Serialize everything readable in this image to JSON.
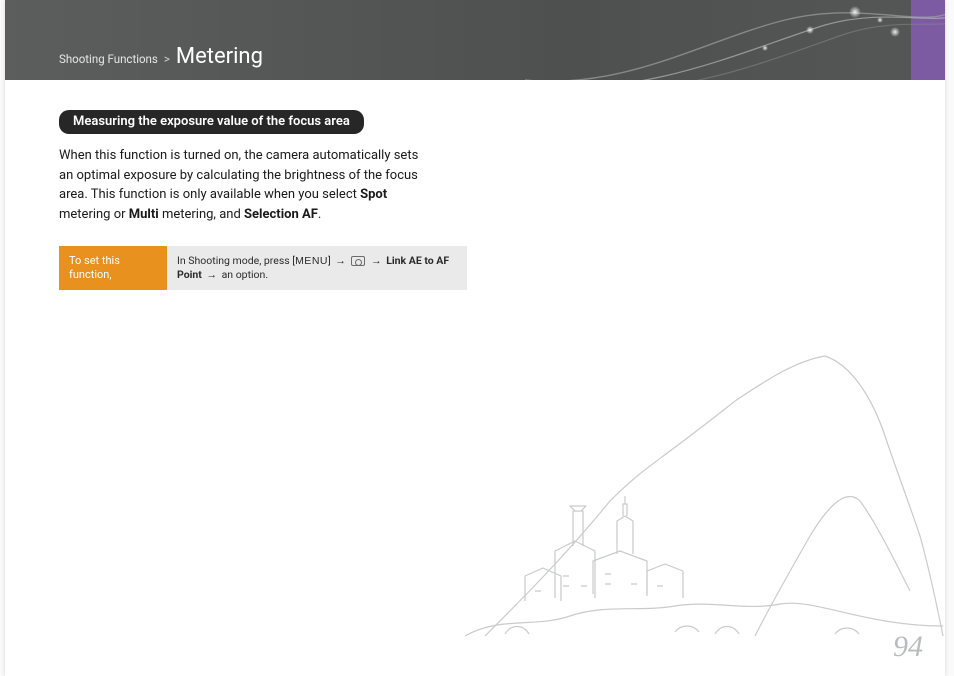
{
  "breadcrumb": {
    "section": "Shooting Functions",
    "separator": ">",
    "title": "Metering"
  },
  "heading": "Measuring the exposure value of the focus area",
  "paragraph": {
    "t1": "When this function is turned on, the camera automatically sets an optimal exposure by calculating the brightness of the focus area. This function is only available when you select ",
    "b1": "Spot",
    "t2": " metering or ",
    "b2": "Multi",
    "t3": " metering, and ",
    "b3": "Selection AF",
    "t4": "."
  },
  "setting": {
    "label": "To set this function,",
    "pre": "In Shooting mode, press [",
    "menu": "MENU",
    "mid": "] ",
    "arrow": "→",
    "bold": "Link AE to AF Point",
    "post": " an option."
  },
  "page_number": "94"
}
